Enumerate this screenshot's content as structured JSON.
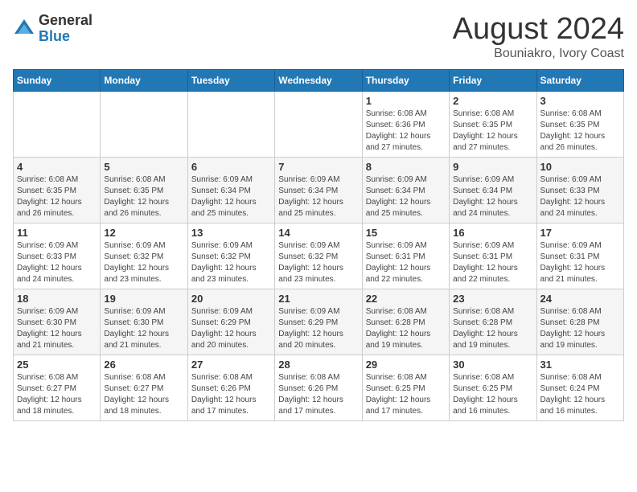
{
  "logo": {
    "general": "General",
    "blue": "Blue"
  },
  "title": "August 2024",
  "subtitle": "Bouniakro, Ivory Coast",
  "days_header": [
    "Sunday",
    "Monday",
    "Tuesday",
    "Wednesday",
    "Thursday",
    "Friday",
    "Saturday"
  ],
  "weeks": [
    [
      {
        "num": "",
        "info": ""
      },
      {
        "num": "",
        "info": ""
      },
      {
        "num": "",
        "info": ""
      },
      {
        "num": "",
        "info": ""
      },
      {
        "num": "1",
        "info": "Sunrise: 6:08 AM\nSunset: 6:36 PM\nDaylight: 12 hours and 27 minutes."
      },
      {
        "num": "2",
        "info": "Sunrise: 6:08 AM\nSunset: 6:35 PM\nDaylight: 12 hours and 27 minutes."
      },
      {
        "num": "3",
        "info": "Sunrise: 6:08 AM\nSunset: 6:35 PM\nDaylight: 12 hours and 26 minutes."
      }
    ],
    [
      {
        "num": "4",
        "info": "Sunrise: 6:08 AM\nSunset: 6:35 PM\nDaylight: 12 hours and 26 minutes."
      },
      {
        "num": "5",
        "info": "Sunrise: 6:08 AM\nSunset: 6:35 PM\nDaylight: 12 hours and 26 minutes."
      },
      {
        "num": "6",
        "info": "Sunrise: 6:09 AM\nSunset: 6:34 PM\nDaylight: 12 hours and 25 minutes."
      },
      {
        "num": "7",
        "info": "Sunrise: 6:09 AM\nSunset: 6:34 PM\nDaylight: 12 hours and 25 minutes."
      },
      {
        "num": "8",
        "info": "Sunrise: 6:09 AM\nSunset: 6:34 PM\nDaylight: 12 hours and 25 minutes."
      },
      {
        "num": "9",
        "info": "Sunrise: 6:09 AM\nSunset: 6:34 PM\nDaylight: 12 hours and 24 minutes."
      },
      {
        "num": "10",
        "info": "Sunrise: 6:09 AM\nSunset: 6:33 PM\nDaylight: 12 hours and 24 minutes."
      }
    ],
    [
      {
        "num": "11",
        "info": "Sunrise: 6:09 AM\nSunset: 6:33 PM\nDaylight: 12 hours and 24 minutes."
      },
      {
        "num": "12",
        "info": "Sunrise: 6:09 AM\nSunset: 6:32 PM\nDaylight: 12 hours and 23 minutes."
      },
      {
        "num": "13",
        "info": "Sunrise: 6:09 AM\nSunset: 6:32 PM\nDaylight: 12 hours and 23 minutes."
      },
      {
        "num": "14",
        "info": "Sunrise: 6:09 AM\nSunset: 6:32 PM\nDaylight: 12 hours and 23 minutes."
      },
      {
        "num": "15",
        "info": "Sunrise: 6:09 AM\nSunset: 6:31 PM\nDaylight: 12 hours and 22 minutes."
      },
      {
        "num": "16",
        "info": "Sunrise: 6:09 AM\nSunset: 6:31 PM\nDaylight: 12 hours and 22 minutes."
      },
      {
        "num": "17",
        "info": "Sunrise: 6:09 AM\nSunset: 6:31 PM\nDaylight: 12 hours and 21 minutes."
      }
    ],
    [
      {
        "num": "18",
        "info": "Sunrise: 6:09 AM\nSunset: 6:30 PM\nDaylight: 12 hours and 21 minutes."
      },
      {
        "num": "19",
        "info": "Sunrise: 6:09 AM\nSunset: 6:30 PM\nDaylight: 12 hours and 21 minutes."
      },
      {
        "num": "20",
        "info": "Sunrise: 6:09 AM\nSunset: 6:29 PM\nDaylight: 12 hours and 20 minutes."
      },
      {
        "num": "21",
        "info": "Sunrise: 6:09 AM\nSunset: 6:29 PM\nDaylight: 12 hours and 20 minutes."
      },
      {
        "num": "22",
        "info": "Sunrise: 6:08 AM\nSunset: 6:28 PM\nDaylight: 12 hours and 19 minutes."
      },
      {
        "num": "23",
        "info": "Sunrise: 6:08 AM\nSunset: 6:28 PM\nDaylight: 12 hours and 19 minutes."
      },
      {
        "num": "24",
        "info": "Sunrise: 6:08 AM\nSunset: 6:28 PM\nDaylight: 12 hours and 19 minutes."
      }
    ],
    [
      {
        "num": "25",
        "info": "Sunrise: 6:08 AM\nSunset: 6:27 PM\nDaylight: 12 hours and 18 minutes."
      },
      {
        "num": "26",
        "info": "Sunrise: 6:08 AM\nSunset: 6:27 PM\nDaylight: 12 hours and 18 minutes."
      },
      {
        "num": "27",
        "info": "Sunrise: 6:08 AM\nSunset: 6:26 PM\nDaylight: 12 hours and 17 minutes."
      },
      {
        "num": "28",
        "info": "Sunrise: 6:08 AM\nSunset: 6:26 PM\nDaylight: 12 hours and 17 minutes."
      },
      {
        "num": "29",
        "info": "Sunrise: 6:08 AM\nSunset: 6:25 PM\nDaylight: 12 hours and 17 minutes."
      },
      {
        "num": "30",
        "info": "Sunrise: 6:08 AM\nSunset: 6:25 PM\nDaylight: 12 hours and 16 minutes."
      },
      {
        "num": "31",
        "info": "Sunrise: 6:08 AM\nSunset: 6:24 PM\nDaylight: 12 hours and 16 minutes."
      }
    ]
  ]
}
